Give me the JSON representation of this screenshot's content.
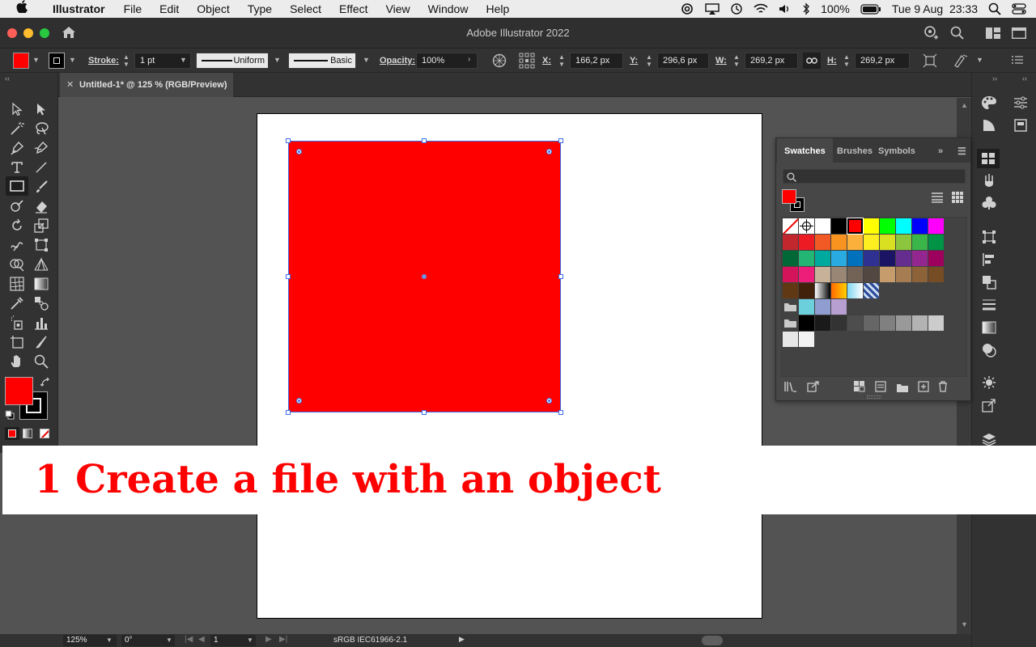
{
  "menubar": {
    "app": "Illustrator",
    "items": [
      "File",
      "Edit",
      "Object",
      "Type",
      "Select",
      "Effect",
      "View",
      "Window",
      "Help"
    ],
    "battery": "100%",
    "datetime": "Tue 9 Aug  23:33"
  },
  "window": {
    "title": "Adobe Illustrator 2022"
  },
  "control": {
    "stroke_label": "Stroke:",
    "stroke_value": "1 pt",
    "profile": "Uniform",
    "brush": "Basic",
    "opacity_label": "Opacity:",
    "opacity_value": "100%",
    "x_label": "X:",
    "x_value": "166,2 px",
    "y_label": "Y:",
    "y_value": "296,6 px",
    "w_label": "W:",
    "w_value": "269,2 px",
    "h_label": "H:",
    "h_value": "269,2 px"
  },
  "document": {
    "tab": "Untitled-1* @ 125 % (RGB/Preview)"
  },
  "statusbar": {
    "zoom": "125%",
    "rotation": "0°",
    "artboard": "1",
    "profile": "sRGB IEC61966-2.1"
  },
  "swatches": {
    "tabs": [
      "Swatches",
      "Brushes",
      "Symbols"
    ],
    "rows": [
      [
        "none",
        "reg",
        "#ffffff",
        "#000000",
        "#ff0000",
        "#ffff00",
        "#00ff00",
        "#00ffff",
        "#0000ff",
        "#ff00ff"
      ],
      [
        "#c1272d",
        "#ed1c24",
        "#f15a24",
        "#f7931e",
        "#fbb03b",
        "#fcee21",
        "#d9e021",
        "#8cc63f",
        "#39b54a",
        "#009245"
      ],
      [
        "#006837",
        "#22b573",
        "#00a99d",
        "#29abe2",
        "#0071bc",
        "#2e3192",
        "#1b1464",
        "#662d91",
        "#93278f",
        "#9e005d"
      ],
      [
        "#d4145a",
        "#ed1e79",
        "#c7b299",
        "#998675",
        "#736357",
        "#534741",
        "#c69c6d",
        "#a67c52",
        "#8c6239",
        "#754c24"
      ],
      [
        "#603813",
        "#42210b",
        "grad-bw",
        "grad-orange",
        "grad-check",
        "pattern"
      ],
      [
        "folder",
        "#6ccfdc",
        "#8f9dd1",
        "#b79fd2"
      ],
      [
        "folder",
        "#000000",
        "#1a1a1a",
        "#333333",
        "#4d4d4d",
        "#666666",
        "#808080",
        "#999999",
        "#b3b3b3",
        "#cccccc"
      ],
      [
        "#e6e6e6",
        "#f2f2f2"
      ]
    ]
  },
  "caption": {
    "text": "1 Create a file with an object"
  }
}
